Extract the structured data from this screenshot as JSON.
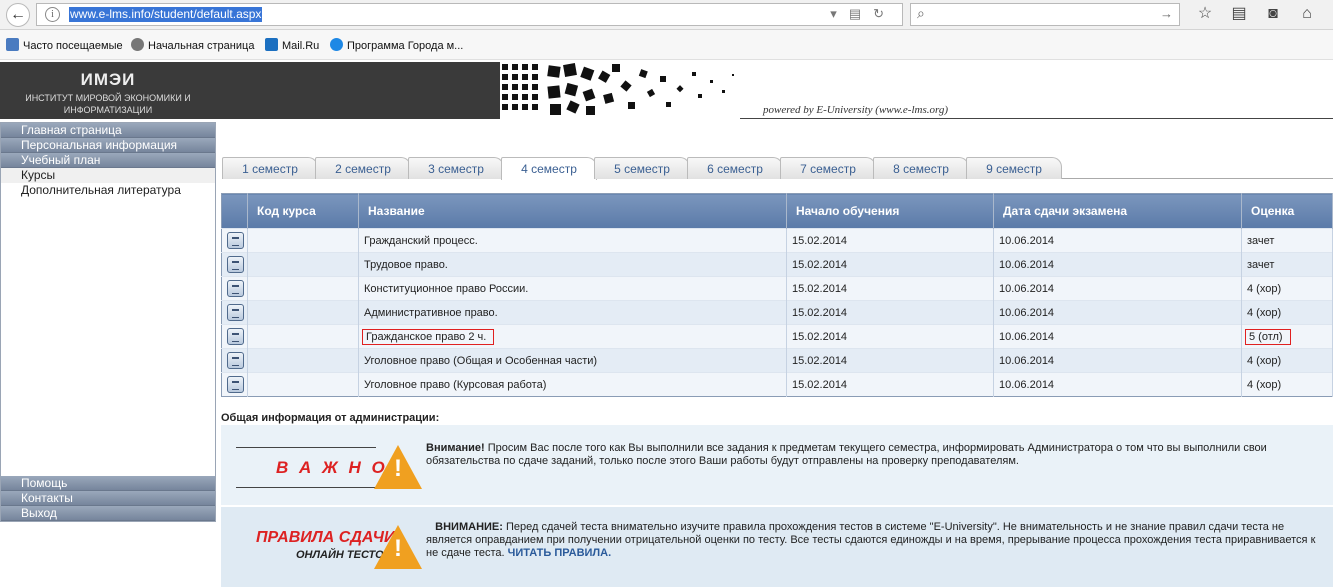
{
  "browser": {
    "url": "www.e-lms.info/student/default.aspx",
    "bookmarks": [
      "Часто посещаемые",
      "Начальная страница",
      "Mail.Ru",
      "Программа Города м..."
    ]
  },
  "header": {
    "logo_title": "ИМЭИ",
    "logo_subtitle_1": "ИНСТИТУТ МИРОВОЙ ЭКОНОМИКИ И",
    "logo_subtitle_2": "ИНФОРМАТИЗАЦИИ",
    "powered_by": "powered by E-University (www.e-lms.org)"
  },
  "sidebar": {
    "items": [
      "Главная страница",
      "Персональная информация",
      "Учебный план"
    ],
    "subitems": [
      "Курсы",
      "Дополнительная литература"
    ],
    "bottom_items": [
      "Помощь",
      "Контакты",
      "Выход"
    ]
  },
  "tabs": [
    "1 семестр",
    "2 семестр",
    "3 семестр",
    "4 семестр",
    "5 семестр",
    "6 семестр",
    "7 семестр",
    "8 семестр",
    "9 семестр"
  ],
  "active_tab": "4 семестр",
  "table": {
    "columns": [
      "Код курса",
      "Название",
      "Начало обучения",
      "Дата сдачи экзамена",
      "Оценка"
    ],
    "rows": [
      {
        "code": "",
        "name": "Гражданский процесс.",
        "start": "15.02.2014",
        "exam": "10.06.2014",
        "grade": "зачет"
      },
      {
        "code": "",
        "name": "Трудовое право.",
        "start": "15.02.2014",
        "exam": "10.06.2014",
        "grade": "зачет"
      },
      {
        "code": "",
        "name": "Конституционное право России.",
        "start": "15.02.2014",
        "exam": "10.06.2014",
        "grade": "4 (хор)"
      },
      {
        "code": "",
        "name": "Административное право.",
        "start": "15.02.2014",
        "exam": "10.06.2014",
        "grade": "4 (хор)"
      },
      {
        "code": "",
        "name": "Гражданское право 2 ч.",
        "start": "15.02.2014",
        "exam": "10.06.2014",
        "grade": "5 (отл)"
      },
      {
        "code": "",
        "name": "Уголовное право (Общая и Особенная части)",
        "start": "15.02.2014",
        "exam": "10.06.2014",
        "grade": "4 (хор)"
      },
      {
        "code": "",
        "name": "Уголовное право (Курсовая работа)",
        "start": "15.02.2014",
        "exam": "10.06.2014",
        "grade": "4 (хор)"
      }
    ]
  },
  "admin": {
    "title": "Общая информация от администрации:",
    "notice1_banner": "В А Ж Н О !",
    "notice1_bold": "Внимание!",
    "notice1_text": " Просим Вас после того как Вы выполнили все задания  к предметам текущего семестра, информировать Администратора о том что вы выполнили свои обязательства по сдаче заданий, только после этого Ваши работы будут отправлены на проверку преподавателям.",
    "notice2_banner": "ПРАВИЛА СДАЧИ",
    "notice2_banner_sub": "ОНЛАЙН ТЕСТОВ",
    "notice2_bold": "ВНИМАНИЕ:",
    "notice2_text": " Перед сдачей теста внимательно изучите правила прохождения тестов в системе \"E-University\". Не внимательность и не знание правил сдачи теста не является оправданием при получении отрицательной оценки по тесту. Все тесты сдаются единожды и на время, прерывание процесса прохождения теста приравнивается к не сдаче теста. ",
    "notice2_link": "ЧИТАТЬ ПРАВИЛА."
  },
  "colors": {
    "sidebar_bar": "#76859c",
    "table_header": "#5a7aa8",
    "tab_text": "#3a5f92",
    "warning": "#d22222",
    "highlight_box": "#e02020"
  }
}
